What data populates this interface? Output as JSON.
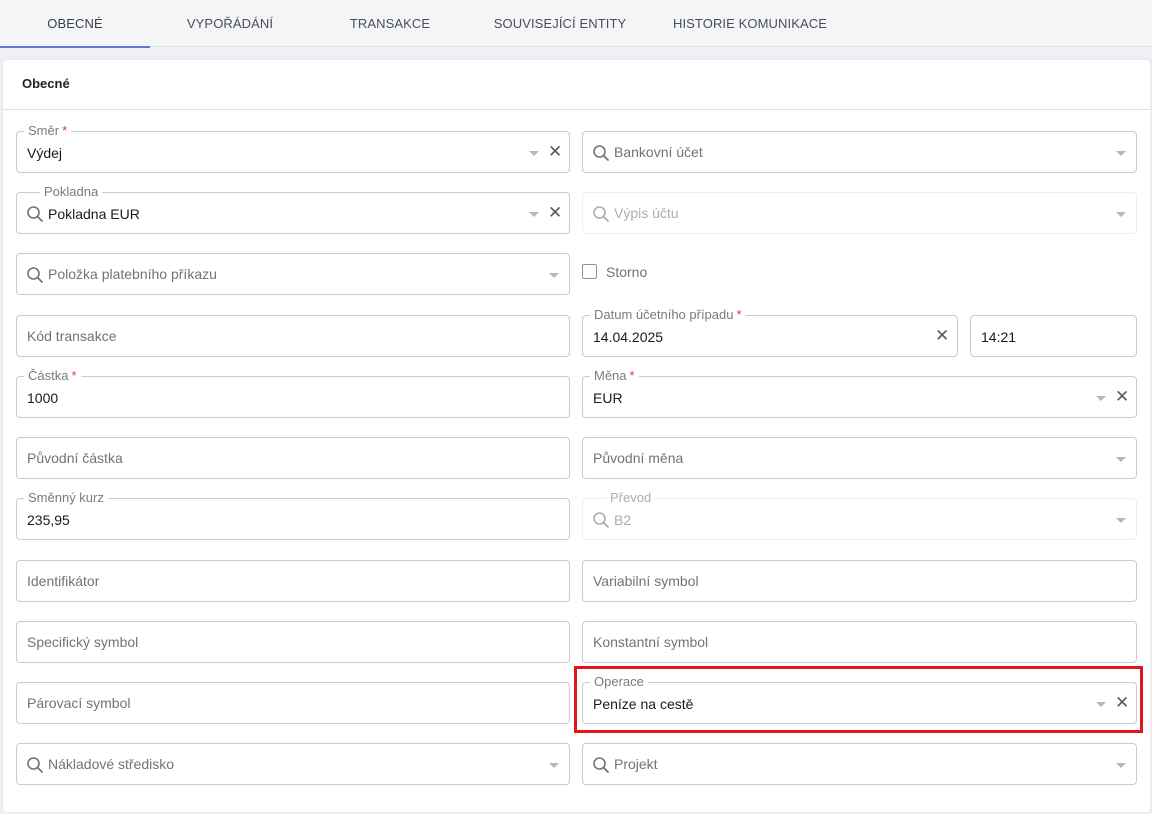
{
  "tabs": [
    {
      "label": "OBECNÉ",
      "active": true
    },
    {
      "label": "VYPOŘÁDÁNÍ"
    },
    {
      "label": "TRANSAKCE"
    },
    {
      "label": "SOUVISEJÍCÍ ENTITY"
    },
    {
      "label": "HISTORIE KOMUNIKACE"
    }
  ],
  "section": {
    "title": "Obecné"
  },
  "fields": {
    "smer": {
      "label": "Směr",
      "required": "*",
      "value": "Výdej"
    },
    "bankovni_ucet": {
      "placeholder": "Bankovní účet"
    },
    "pokladna": {
      "label": "Pokladna",
      "value": "Pokladna EUR"
    },
    "vypis_uctu": {
      "placeholder": "Výpis účtu"
    },
    "polozka": {
      "placeholder": "Položka platebního příkazu"
    },
    "storno": {
      "label": "Storno",
      "checked": false
    },
    "kod_transakce": {
      "placeholder": "Kód transakce"
    },
    "datum": {
      "label": "Datum účetního případu",
      "required": "*",
      "value": "14.04.2025"
    },
    "cas": {
      "value": "14:21"
    },
    "castka": {
      "label": "Částka",
      "required": "*",
      "value": "1000"
    },
    "mena": {
      "label": "Měna",
      "required": "*",
      "value": "EUR"
    },
    "puvodni_castka": {
      "placeholder": "Původní částka"
    },
    "puvodni_mena": {
      "placeholder": "Původní měna"
    },
    "smenny_kurz": {
      "label": "Směnný kurz",
      "value": "235,95"
    },
    "prevod": {
      "label": "Převod",
      "value": "B2"
    },
    "identifikator": {
      "placeholder": "Identifikátor"
    },
    "variabilni": {
      "placeholder": "Variabilní symbol"
    },
    "specificky": {
      "placeholder": "Specifický symbol"
    },
    "konstantni": {
      "placeholder": "Konstantní symbol"
    },
    "parovaci": {
      "placeholder": "Párovací symbol"
    },
    "operace": {
      "label": "Operace",
      "value": "Peníze na cestě"
    },
    "nakladove": {
      "placeholder": "Nákladové středisko"
    },
    "projekt": {
      "placeholder": "Projekt"
    }
  },
  "colors": {
    "accent": "#5b7bd5",
    "required": "#e53935",
    "highlight": "#e0161b"
  }
}
